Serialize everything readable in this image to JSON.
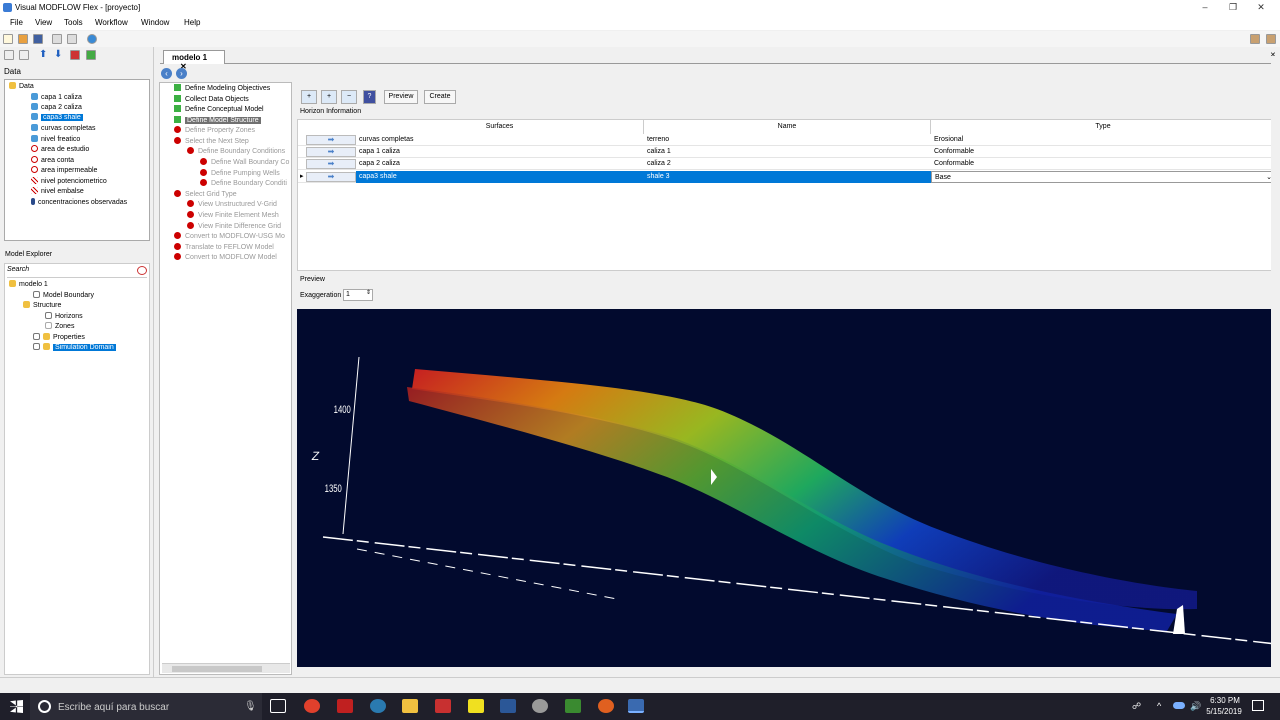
{
  "window": {
    "title": "Visual MODFLOW Flex - [proyecto]",
    "minimize": "–",
    "maximize": "❐",
    "close": "✕"
  },
  "menu": [
    "File",
    "View",
    "Tools",
    "Workflow",
    "Window",
    "Help"
  ],
  "data_panel": {
    "label": "Data",
    "root": "Data",
    "items": [
      "capa 1 caliza",
      "capa 2 caliza",
      "capa3 shale",
      "curvas completas",
      "nivel freatico",
      "area de estudio",
      "area conta",
      "area impermeable",
      "nivel potenciometrico",
      "nivel embalse",
      "concentraciones observadas"
    ],
    "selected_index": 2
  },
  "model_explorer": {
    "label": "Model Explorer",
    "search_placeholder": "Search",
    "nodes": [
      "modelo 1",
      "Model Boundary",
      "Structure",
      "Horizons",
      "Zones",
      "Properties",
      "Simulation Domain"
    ]
  },
  "tab": {
    "label": "modelo 1",
    "close": "✕"
  },
  "workflow": [
    {
      "label": "Define Modeling Objectives",
      "state": "done"
    },
    {
      "label": "Collect Data Objects",
      "state": "done"
    },
    {
      "label": "Define Conceptual Model",
      "state": "done"
    },
    {
      "label": "Define Model Structure",
      "state": "current"
    },
    {
      "label": "Define Property Zones",
      "state": "todo"
    },
    {
      "label": "Select the Next Step",
      "state": "todo"
    },
    {
      "label": "Define Boundary Conditions",
      "state": "todo"
    },
    {
      "label": "Define Wall Boundary Co",
      "state": "todo"
    },
    {
      "label": "Define Pumping Wells",
      "state": "todo"
    },
    {
      "label": "Define Boundary Conditi",
      "state": "todo"
    },
    {
      "label": "Select Grid Type",
      "state": "todo"
    },
    {
      "label": "View Unstructured V-Grid",
      "state": "todo"
    },
    {
      "label": "View Finite Element Mesh",
      "state": "todo"
    },
    {
      "label": "View Finite Difference Grid",
      "state": "todo"
    },
    {
      "label": "Convert to MODFLOW-USG Mo",
      "state": "todo"
    },
    {
      "label": "Translate to FEFLOW Model",
      "state": "todo"
    },
    {
      "label": "Convert to MODFLOW Model",
      "state": "todo"
    }
  ],
  "toolbar2": {
    "preview": "Preview",
    "create": "Create"
  },
  "horizon": {
    "label": "Horizon Information",
    "columns": [
      "Surfaces",
      "Name",
      "Type"
    ],
    "rows": [
      {
        "surface": "curvas completas",
        "name": "terreno",
        "type": "Erosional"
      },
      {
        "surface": "capa 1 caliza",
        "name": "caliza 1",
        "type": "Conformable"
      },
      {
        "surface": "capa 2 caliza",
        "name": "caliza 2",
        "type": "Conformable"
      },
      {
        "surface": "capa3 shale",
        "name": "shale 3",
        "type": "Base"
      }
    ],
    "selected_row": 3
  },
  "preview": {
    "label": "Preview",
    "exaggeration_label": "Exaggeration",
    "exaggeration_value": "1"
  },
  "viewer": {
    "axis_z": "Z",
    "tick_1400": "1400",
    "tick_1350": "1350"
  },
  "taskbar": {
    "search": "Escribe aquí para buscar",
    "time": "6:30 PM",
    "date": "5/15/2019"
  }
}
